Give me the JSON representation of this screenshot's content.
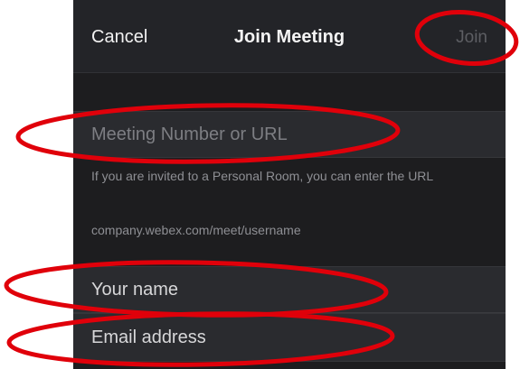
{
  "navbar": {
    "cancel_label": "Cancel",
    "title": "Join Meeting",
    "join_label": "Join"
  },
  "form": {
    "meeting_placeholder": "Meeting Number or URL",
    "help_text": "If you are invited to a Personal Room, you can enter the URL",
    "example_url": "company.webex.com/meet/username",
    "name_placeholder": "Your name",
    "email_placeholder": "Email address"
  },
  "colors": {
    "background": "#1d1d1f",
    "navbar": "#232428",
    "field": "#2a2b2f",
    "disabled_join": "#5d5e63",
    "annotation": "#e0000a"
  }
}
